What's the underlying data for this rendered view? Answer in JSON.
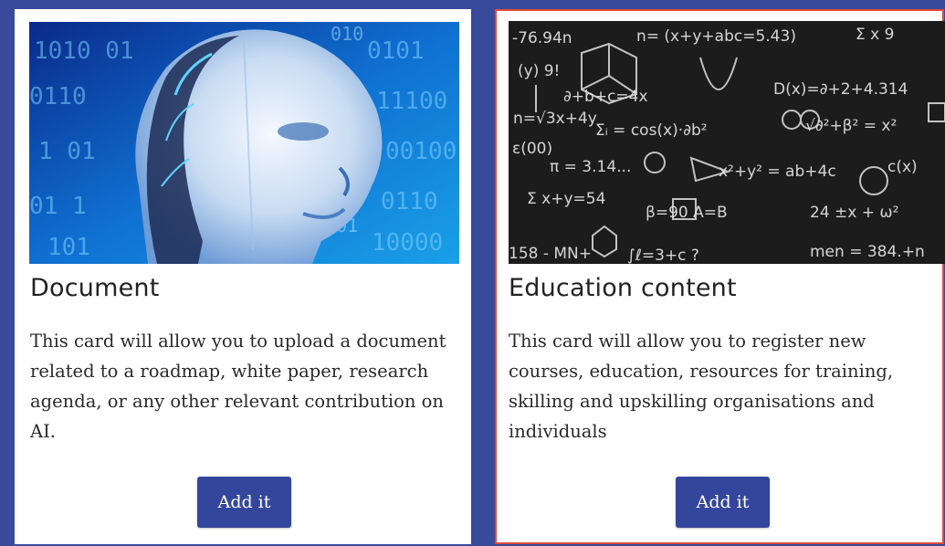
{
  "cards": [
    {
      "title": "Document",
      "description": "This card will allow you to upload a document related to a roadmap, white paper, research agenda, or any other relevant contribution on AI.",
      "button_label": "Add it",
      "image_subject": "robot-head-binary-code"
    },
    {
      "title": "Education content",
      "description": "This card will allow you to register new courses, education, resources for training, skilling and upskilling organisations and individuals",
      "button_label": "Add it",
      "image_subject": "chalkboard-math-formulas"
    }
  ],
  "colors": {
    "page_background": "#3a4a9a",
    "button": "#34469b",
    "selected_border": "#e04a35"
  }
}
